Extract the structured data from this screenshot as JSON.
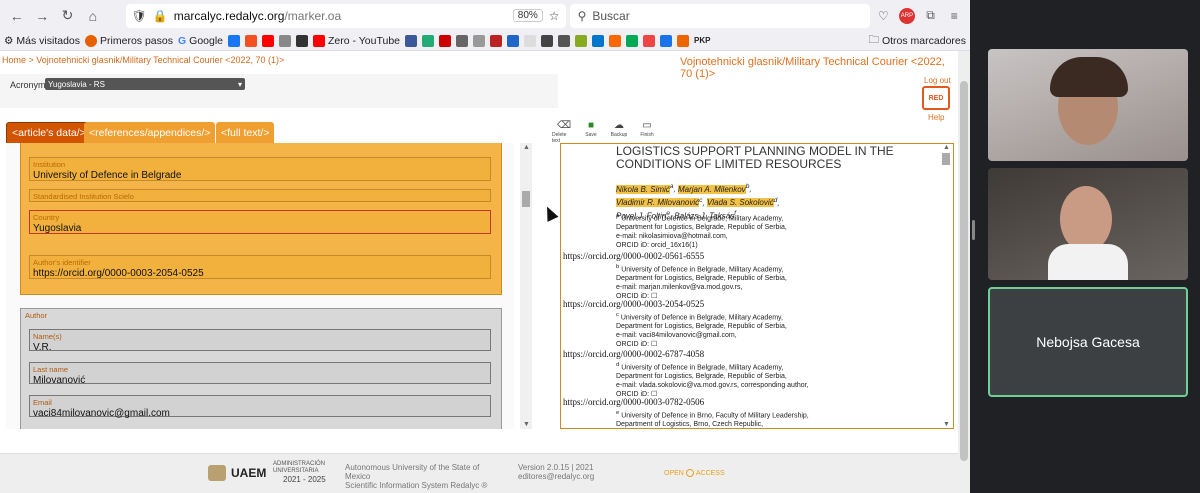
{
  "browser": {
    "url_host": "marcalyc.redalyc.org",
    "url_path": "/marker.oa",
    "zoom": "80%",
    "search_placeholder": "Buscar",
    "profile": "ARP"
  },
  "bookmarks": {
    "items": [
      "Más visitados",
      "Primeros pasos",
      "Google",
      "Zero - YouTube"
    ],
    "other": "Otros marcadores",
    "pkp": "PKP"
  },
  "page": {
    "breadcrumb": "Home > Vojnotehnicki glasnik/Military Technical Courier <2022, 70 (1)>",
    "journal": "Vojnotehnicki glasnik/Military Technical Courier <2022, 70 (1)>",
    "logout": "Log out",
    "help": "Help",
    "logo_text": "RED",
    "acronym_label": "Acronym*:",
    "acronym_value": "Yugoslavia - RS",
    "tabs": [
      "<article's data/>",
      "<references/appendices/>",
      "<full text/>"
    ],
    "tools": [
      "Delete text",
      "Save",
      "Backup",
      "Finish"
    ]
  },
  "form": {
    "top_fields": [
      {
        "label": "Institution",
        "value": "University of Defence in Belgrade"
      },
      {
        "label": "Standardised Institution Scielo",
        "value": ""
      },
      {
        "label": "Country",
        "value": "Yugoslavia"
      }
    ],
    "identifier": {
      "label": "Author's identifier",
      "value": "https://orcid.org/0000-0003-2054-0525"
    },
    "author_title": "Author",
    "author_fields": [
      {
        "label": "Name(s)",
        "value": "V.R."
      },
      {
        "label": "Last name",
        "value": "Milovanović"
      },
      {
        "label": "Email",
        "value": "vaci84milovanovic@gmail.com"
      }
    ]
  },
  "pdf": {
    "title": "LOGISTICS SUPPORT PLANNING MODEL IN THE CONDITIONS OF LIMITED RESOURCES",
    "authors_line1": "Nikola B. Simić",
    "authors_line1b": "Marjan A. Milenkov",
    "authors_line2a": "Vladimir R. Milovanović",
    "authors_line2b": "Vlada S. Sokolović",
    "authors_line3": "Pavel J. Foltin",
    "authors_line3b": "Balázs J. Taksás",
    "affiliations": [
      {
        "lines": [
          "University of Defence in Belgrade, Military Academy,",
          "Department for Logistics, Belgrade, Republic of Serbia,",
          "e-mail: nikolasimiova@hotmail.com,",
          "ORCID iD: orcid_16x16(1)"
        ],
        "orcid": "https://orcid.org/0000-0002-0561-6555"
      },
      {
        "lines": [
          "University of Defence in Belgrade, Military Academy,",
          "Department for Logistics, Belgrade, Republic of Serbia,",
          "e-mail: marjan.milenkov@va.mod.gov.rs,",
          "ORCID iD: ☐"
        ],
        "orcid": "https://orcid.org/0000-0003-2054-0525"
      },
      {
        "lines": [
          "University of Defence in Belgrade, Military Academy,",
          "Department for Logistics, Belgrade, Republic of Serbia,",
          "e-mail: vaci84milovanovic@gmail.com,",
          "ORCID iD: ☐"
        ],
        "orcid": "https://orcid.org/0000-0002-6787-4058"
      },
      {
        "lines": [
          "University of Defence in Belgrade, Military Academy,",
          "Department for Logistics, Belgrade, Republic of Serbia,",
          "e-mail: vlada.sokolovic@va.mod.gov.rs, corresponding author,",
          "ORCID iD: ☐"
        ],
        "orcid": "https://orcid.org/0000-0003-0782-0506"
      },
      {
        "lines": [
          "University of Defence in Brno, Faculty of Military Leadership,",
          "Department of Logistics, Brno, Czech Republic,"
        ],
        "orcid": ""
      }
    ]
  },
  "footer": {
    "uaem": "UAEM",
    "uaem_sub1": "ADMINISTRACIÓN",
    "uaem_sub2": "UNIVERSITARIA",
    "uaem_years": "2021 - 2025",
    "univ": "Autonomous University of the State of Mexico",
    "scientific": "Scientific Information System Redalyc ®",
    "version": "Version 2.0.15 | 2021",
    "email": "editores@redalyc.org",
    "oa_open": "OPEN",
    "oa_access": "ACCESS"
  },
  "meet": {
    "participant": "Nebojsa Gacesa"
  }
}
